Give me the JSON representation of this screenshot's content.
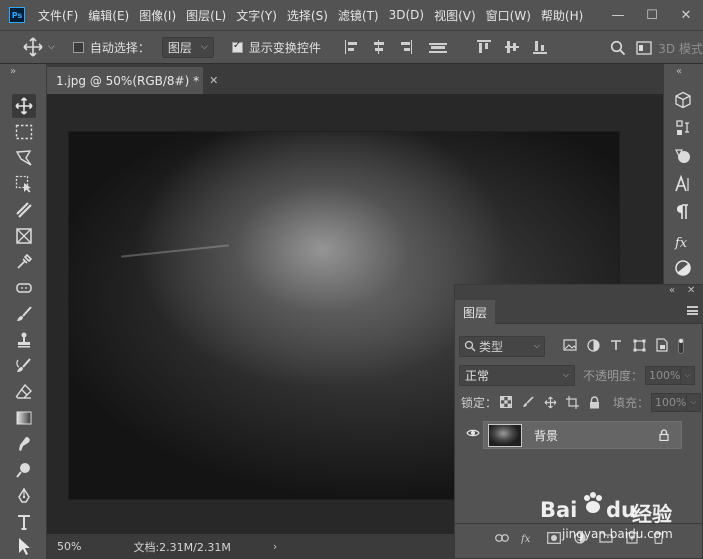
{
  "app": {
    "logo_text": "Ps",
    "colors": {
      "accent": "#31a8ff",
      "panel_bg": "#535353",
      "chrome_dark": "#3b3b3b",
      "canvas_bg": "#282828"
    }
  },
  "menubar": {
    "items": [
      "文件(F)",
      "编辑(E)",
      "图像(I)",
      "图层(L)",
      "文字(Y)",
      "选择(S)",
      "滤镜(T)",
      "3D(D)",
      "视图(V)",
      "窗口(W)",
      "帮助(H)"
    ],
    "window_controls": [
      "—",
      "☐",
      "✕"
    ]
  },
  "optionsbar": {
    "auto_select_label": "自动选择：",
    "auto_select_checked": false,
    "auto_select_target": "图层",
    "show_transform_label": "显示变换控件",
    "show_transform_checked": true,
    "mode_3d_label": "3D 模式"
  },
  "toolbar": {
    "collapse": "»",
    "tools": [
      "move",
      "marquee",
      "lasso",
      "object-select",
      "crop",
      "frame",
      "eyedropper",
      "healing",
      "brush",
      "stamp",
      "history-brush",
      "eraser",
      "gradient",
      "smudge",
      "dodge",
      "pen",
      "text",
      "path-select"
    ]
  },
  "document": {
    "tab_title": "1.jpg @ 50%(RGB/8#) *",
    "tab_close": "✕"
  },
  "statusbar": {
    "zoom": "50%",
    "doc_info": "文档:2.31M/2.31M",
    "arrow": "›"
  },
  "right_strip": {
    "collapse": "«",
    "icons": [
      "3d-icon",
      "adjust-icon",
      "shape-icon",
      "character-icon",
      "paragraph-icon",
      "fx-icon",
      "contrast-icon"
    ]
  },
  "layers_panel": {
    "collapse": "«",
    "close": "✕",
    "tab_label": "图层",
    "filter_label": "类型",
    "blend_mode": "正常",
    "opacity_label": "不透明度：",
    "opacity_value": "100%",
    "lock_label": "锁定：",
    "fill_label": "填充：",
    "fill_value": "100%",
    "layers": [
      {
        "name": "背景",
        "visible": true,
        "locked": true
      }
    ],
    "bottom_actions": [
      "link-icon",
      "fx-icon",
      "mask-icon",
      "adjustment-icon",
      "group-icon",
      "new-layer-icon",
      "delete-icon"
    ]
  },
  "watermark": {
    "brand": "Baidu",
    "logo_text": "Bai",
    "logo_suffix": "du",
    "product": "经验",
    "url": "jingyan.baidu.com"
  }
}
